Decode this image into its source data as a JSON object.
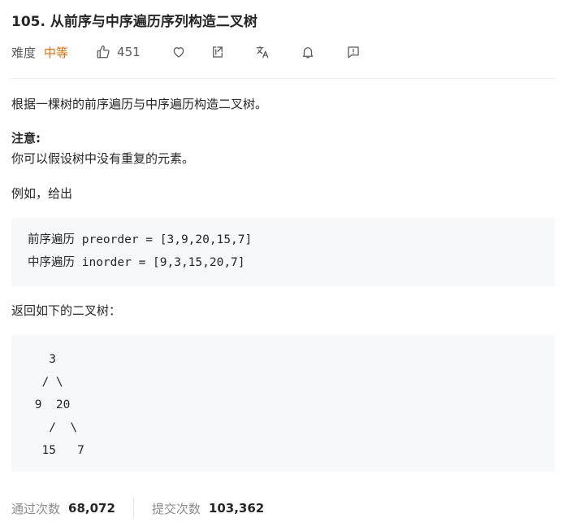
{
  "problem": {
    "title": "105. 从前序与中序遍历序列构造二叉树",
    "difficulty_label": "难度",
    "difficulty": "中等",
    "like_count": "451",
    "difficulty_color": "#ef6c00"
  },
  "toolbar": {
    "icons": [
      "thumbs-up-icon",
      "heart-icon",
      "share-icon",
      "translate-icon",
      "bell-icon",
      "feedback-icon"
    ]
  },
  "description": {
    "intro": "根据一棵树的前序遍历与中序遍历构造二叉树。",
    "note_label": "注意:",
    "note_text": "你可以假设树中没有重复的元素。",
    "example_intro": "例如，给出",
    "preorder_line": "前序遍历 preorder = [3,9,20,15,7]",
    "inorder_line": "中序遍历 inorder = [9,3,15,20,7]",
    "tree_intro": "返回如下的二叉树：",
    "tree_ascii": "   3\n  / \\\n 9  20\n   /  \\\n  15   7"
  },
  "stats": {
    "accepted_label": "通过次数",
    "accepted_value": "68,072",
    "submitted_label": "提交次数",
    "submitted_value": "103,362"
  }
}
